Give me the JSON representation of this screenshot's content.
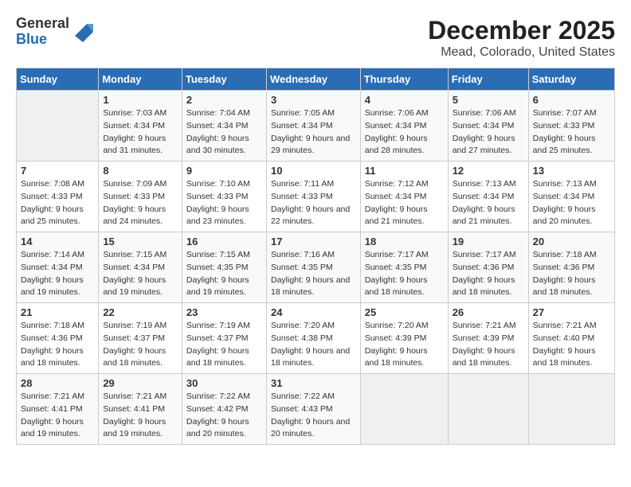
{
  "logo": {
    "general": "General",
    "blue": "Blue"
  },
  "title": "December 2025",
  "subtitle": "Mead, Colorado, United States",
  "days_of_week": [
    "Sunday",
    "Monday",
    "Tuesday",
    "Wednesday",
    "Thursday",
    "Friday",
    "Saturday"
  ],
  "weeks": [
    [
      {
        "num": "",
        "sunrise": "",
        "sunset": "",
        "daylight": ""
      },
      {
        "num": "1",
        "sunrise": "Sunrise: 7:03 AM",
        "sunset": "Sunset: 4:34 PM",
        "daylight": "Daylight: 9 hours and 31 minutes."
      },
      {
        "num": "2",
        "sunrise": "Sunrise: 7:04 AM",
        "sunset": "Sunset: 4:34 PM",
        "daylight": "Daylight: 9 hours and 30 minutes."
      },
      {
        "num": "3",
        "sunrise": "Sunrise: 7:05 AM",
        "sunset": "Sunset: 4:34 PM",
        "daylight": "Daylight: 9 hours and 29 minutes."
      },
      {
        "num": "4",
        "sunrise": "Sunrise: 7:06 AM",
        "sunset": "Sunset: 4:34 PM",
        "daylight": "Daylight: 9 hours and 28 minutes."
      },
      {
        "num": "5",
        "sunrise": "Sunrise: 7:06 AM",
        "sunset": "Sunset: 4:34 PM",
        "daylight": "Daylight: 9 hours and 27 minutes."
      },
      {
        "num": "6",
        "sunrise": "Sunrise: 7:07 AM",
        "sunset": "Sunset: 4:33 PM",
        "daylight": "Daylight: 9 hours and 25 minutes."
      }
    ],
    [
      {
        "num": "7",
        "sunrise": "Sunrise: 7:08 AM",
        "sunset": "Sunset: 4:33 PM",
        "daylight": "Daylight: 9 hours and 25 minutes."
      },
      {
        "num": "8",
        "sunrise": "Sunrise: 7:09 AM",
        "sunset": "Sunset: 4:33 PM",
        "daylight": "Daylight: 9 hours and 24 minutes."
      },
      {
        "num": "9",
        "sunrise": "Sunrise: 7:10 AM",
        "sunset": "Sunset: 4:33 PM",
        "daylight": "Daylight: 9 hours and 23 minutes."
      },
      {
        "num": "10",
        "sunrise": "Sunrise: 7:11 AM",
        "sunset": "Sunset: 4:33 PM",
        "daylight": "Daylight: 9 hours and 22 minutes."
      },
      {
        "num": "11",
        "sunrise": "Sunrise: 7:12 AM",
        "sunset": "Sunset: 4:34 PM",
        "daylight": "Daylight: 9 hours and 21 minutes."
      },
      {
        "num": "12",
        "sunrise": "Sunrise: 7:13 AM",
        "sunset": "Sunset: 4:34 PM",
        "daylight": "Daylight: 9 hours and 21 minutes."
      },
      {
        "num": "13",
        "sunrise": "Sunrise: 7:13 AM",
        "sunset": "Sunset: 4:34 PM",
        "daylight": "Daylight: 9 hours and 20 minutes."
      }
    ],
    [
      {
        "num": "14",
        "sunrise": "Sunrise: 7:14 AM",
        "sunset": "Sunset: 4:34 PM",
        "daylight": "Daylight: 9 hours and 19 minutes."
      },
      {
        "num": "15",
        "sunrise": "Sunrise: 7:15 AM",
        "sunset": "Sunset: 4:34 PM",
        "daylight": "Daylight: 9 hours and 19 minutes."
      },
      {
        "num": "16",
        "sunrise": "Sunrise: 7:15 AM",
        "sunset": "Sunset: 4:35 PM",
        "daylight": "Daylight: 9 hours and 19 minutes."
      },
      {
        "num": "17",
        "sunrise": "Sunrise: 7:16 AM",
        "sunset": "Sunset: 4:35 PM",
        "daylight": "Daylight: 9 hours and 18 minutes."
      },
      {
        "num": "18",
        "sunrise": "Sunrise: 7:17 AM",
        "sunset": "Sunset: 4:35 PM",
        "daylight": "Daylight: 9 hours and 18 minutes."
      },
      {
        "num": "19",
        "sunrise": "Sunrise: 7:17 AM",
        "sunset": "Sunset: 4:36 PM",
        "daylight": "Daylight: 9 hours and 18 minutes."
      },
      {
        "num": "20",
        "sunrise": "Sunrise: 7:18 AM",
        "sunset": "Sunset: 4:36 PM",
        "daylight": "Daylight: 9 hours and 18 minutes."
      }
    ],
    [
      {
        "num": "21",
        "sunrise": "Sunrise: 7:18 AM",
        "sunset": "Sunset: 4:36 PM",
        "daylight": "Daylight: 9 hours and 18 minutes."
      },
      {
        "num": "22",
        "sunrise": "Sunrise: 7:19 AM",
        "sunset": "Sunset: 4:37 PM",
        "daylight": "Daylight: 9 hours and 18 minutes."
      },
      {
        "num": "23",
        "sunrise": "Sunrise: 7:19 AM",
        "sunset": "Sunset: 4:37 PM",
        "daylight": "Daylight: 9 hours and 18 minutes."
      },
      {
        "num": "24",
        "sunrise": "Sunrise: 7:20 AM",
        "sunset": "Sunset: 4:38 PM",
        "daylight": "Daylight: 9 hours and 18 minutes."
      },
      {
        "num": "25",
        "sunrise": "Sunrise: 7:20 AM",
        "sunset": "Sunset: 4:39 PM",
        "daylight": "Daylight: 9 hours and 18 minutes."
      },
      {
        "num": "26",
        "sunrise": "Sunrise: 7:21 AM",
        "sunset": "Sunset: 4:39 PM",
        "daylight": "Daylight: 9 hours and 18 minutes."
      },
      {
        "num": "27",
        "sunrise": "Sunrise: 7:21 AM",
        "sunset": "Sunset: 4:40 PM",
        "daylight": "Daylight: 9 hours and 18 minutes."
      }
    ],
    [
      {
        "num": "28",
        "sunrise": "Sunrise: 7:21 AM",
        "sunset": "Sunset: 4:41 PM",
        "daylight": "Daylight: 9 hours and 19 minutes."
      },
      {
        "num": "29",
        "sunrise": "Sunrise: 7:21 AM",
        "sunset": "Sunset: 4:41 PM",
        "daylight": "Daylight: 9 hours and 19 minutes."
      },
      {
        "num": "30",
        "sunrise": "Sunrise: 7:22 AM",
        "sunset": "Sunset: 4:42 PM",
        "daylight": "Daylight: 9 hours and 20 minutes."
      },
      {
        "num": "31",
        "sunrise": "Sunrise: 7:22 AM",
        "sunset": "Sunset: 4:43 PM",
        "daylight": "Daylight: 9 hours and 20 minutes."
      },
      {
        "num": "",
        "sunrise": "",
        "sunset": "",
        "daylight": ""
      },
      {
        "num": "",
        "sunrise": "",
        "sunset": "",
        "daylight": ""
      },
      {
        "num": "",
        "sunrise": "",
        "sunset": "",
        "daylight": ""
      }
    ]
  ]
}
